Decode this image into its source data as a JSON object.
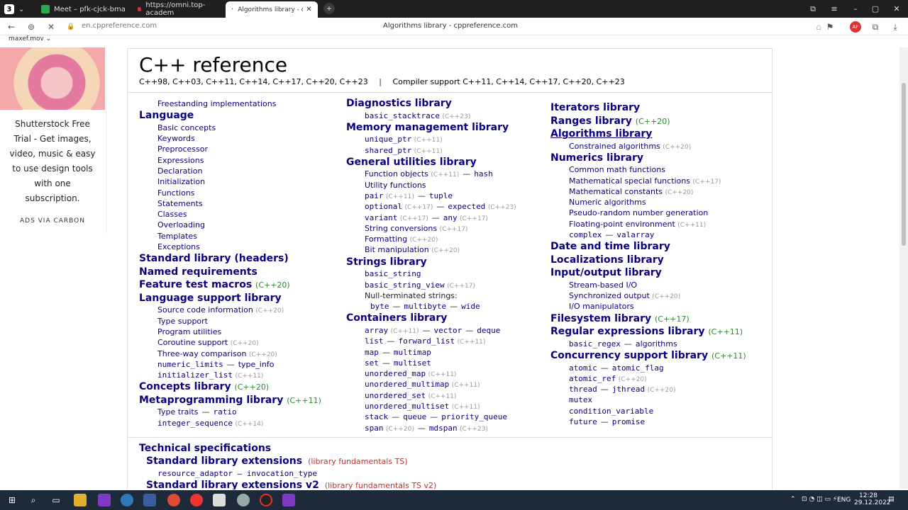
{
  "browser": {
    "tab_counter": "3",
    "tabs": [
      {
        "label": "Meet – pfk-cjck-bma"
      },
      {
        "label": "https://omni.top-academ"
      },
      {
        "label": "Algorithms library - cpp"
      }
    ],
    "new_tab": "+",
    "url": "en.cppreference.com",
    "page_title": "Algorithms library - cppreference.com",
    "bookmark": "maxef.mov"
  },
  "ad": {
    "text": "Shutterstock Free Trial - Get images, video, music & easy to use design tools with one subscription.",
    "via": "ADS VIA CARBON"
  },
  "page": {
    "title": "C++ reference",
    "versions_left": "C++98, C++03, C++11, C++14, C++17, C++20, C++23",
    "versions_sep": "|",
    "versions_right": "Compiler support C++11, C++14, C++17, C++20, C++23"
  },
  "col1": [
    {
      "t": "Freestanding implementations",
      "cls": "i"
    },
    {
      "t": "Language",
      "cls": "h"
    },
    {
      "t": "Basic concepts",
      "cls": "i"
    },
    {
      "t": "Keywords",
      "cls": "i"
    },
    {
      "t": "Preprocessor",
      "cls": "i"
    },
    {
      "t": "Expressions",
      "cls": "i"
    },
    {
      "t": "Declaration",
      "cls": "i"
    },
    {
      "t": "Initialization",
      "cls": "i"
    },
    {
      "t": "Functions",
      "cls": "i"
    },
    {
      "t": "Statements",
      "cls": "i"
    },
    {
      "t": "Classes",
      "cls": "i"
    },
    {
      "t": "Overloading",
      "cls": "i"
    },
    {
      "t": "Templates",
      "cls": "i"
    },
    {
      "t": "Exceptions",
      "cls": "i"
    },
    {
      "t": "Standard library (headers)",
      "cls": "h"
    },
    {
      "t": "Named requirements",
      "cls": "h"
    },
    {
      "t": "Feature test macros",
      "cls": "h",
      "v": "(C++20)"
    },
    {
      "t": "Language support library",
      "cls": "h"
    },
    {
      "t": "Source code information",
      "cls": "i",
      "v": "(C++20)"
    },
    {
      "t": "Type support",
      "cls": "i"
    },
    {
      "t": "Program utilities",
      "cls": "i"
    },
    {
      "t": "Coroutine support",
      "cls": "i",
      "v": "(C++20)"
    },
    {
      "t": "Three-way comparison",
      "cls": "i",
      "v": "(C++20)"
    },
    {
      "t": "numeric_limits",
      "cls": "i",
      "mono": true,
      "t2": "type_info"
    },
    {
      "t": "initializer_list",
      "cls": "i",
      "mono": true,
      "v": "(C++11)"
    },
    {
      "t": "Concepts library",
      "cls": "h",
      "v": "(C++20)"
    },
    {
      "t": "Metaprogramming library",
      "cls": "h",
      "v": "(C++11)"
    },
    {
      "t": "Type traits",
      "cls": "i",
      "t2": "ratio",
      "mono2": true
    },
    {
      "t": "integer_sequence",
      "cls": "i",
      "mono": true,
      "v": "(C++14)"
    }
  ],
  "col2": [
    {
      "t": "Diagnostics library",
      "cls": "h"
    },
    {
      "t": "basic_stacktrace",
      "cls": "i",
      "mono": true,
      "v": "(C++23)"
    },
    {
      "t": "Memory management library",
      "cls": "h"
    },
    {
      "t": "unique_ptr",
      "cls": "i",
      "mono": true,
      "v": "(C++11)"
    },
    {
      "t": "shared_ptr",
      "cls": "i",
      "mono": true,
      "v": "(C++11)"
    },
    {
      "t": "General utilities library",
      "cls": "h"
    },
    {
      "t": "Function objects",
      "cls": "i",
      "t2": "hash",
      "mono2": true,
      "v": "(C++11)"
    },
    {
      "t": "Utility functions",
      "cls": "i"
    },
    {
      "t": "pair",
      "cls": "i",
      "mono": true,
      "t2": "tuple",
      "mono2": true,
      "v": "(C++11)"
    },
    {
      "t": "optional",
      "cls": "i",
      "mono": true,
      "v": "(C++17)",
      "t2": "expected",
      "mono2": true,
      "v2": "(C++23)"
    },
    {
      "t": "variant",
      "cls": "i",
      "mono": true,
      "v": "(C++17)",
      "t2": "any",
      "mono2": true,
      "v2": "(C++17)"
    },
    {
      "t": "String conversions",
      "cls": "i",
      "v": "(C++17)"
    },
    {
      "t": "Formatting",
      "cls": "i",
      "v": "(C++20)"
    },
    {
      "t": "Bit manipulation",
      "cls": "i",
      "v": "(C++20)"
    },
    {
      "t": "Strings library",
      "cls": "h"
    },
    {
      "t": "basic_string",
      "cls": "i",
      "mono": true
    },
    {
      "t": "basic_string_view",
      "cls": "i",
      "mono": true,
      "v": "(C++17)"
    },
    {
      "t": "Null-terminated strings:",
      "cls": "i",
      "plain": true
    },
    {
      "t": "byte",
      "cls": "ii",
      "mono": true,
      "t2": "multibyte",
      "mono2": true,
      "t3": "wide",
      "mono3": true
    },
    {
      "t": "Containers library",
      "cls": "h"
    },
    {
      "t": "array",
      "cls": "i",
      "mono": true,
      "v": "(C++11)",
      "t2": "vector",
      "mono2": true,
      "t3": "deque",
      "mono3": true
    },
    {
      "t": "list",
      "cls": "i",
      "mono": true,
      "t2": "forward_list",
      "mono2": true,
      "v2": "(C++11)"
    },
    {
      "t": "map",
      "cls": "i",
      "mono": true,
      "t2": "multimap",
      "mono2": true
    },
    {
      "t": "set",
      "cls": "i",
      "mono": true,
      "t2": "multiset",
      "mono2": true
    },
    {
      "t": "unordered_map",
      "cls": "i",
      "mono": true,
      "v": "(C++11)"
    },
    {
      "t": "unordered_multimap",
      "cls": "i",
      "mono": true,
      "v": "(C++11)"
    },
    {
      "t": "unordered_set",
      "cls": "i",
      "mono": true,
      "v": "(C++11)"
    },
    {
      "t": "unordered_multiset",
      "cls": "i",
      "mono": true,
      "v": "(C++11)"
    },
    {
      "t": "stack",
      "cls": "i",
      "mono": true,
      "t2": "queue",
      "mono2": true,
      "t3": "priority_queue",
      "mono3": true
    },
    {
      "t": "span",
      "cls": "i",
      "mono": true,
      "v": "(C++20)",
      "t2": "mdspan",
      "mono2": true,
      "v2": "(C++23)"
    }
  ],
  "col3": [
    {
      "t": "Iterators library",
      "cls": "h"
    },
    {
      "t": "Ranges library",
      "cls": "h",
      "v": "(C++20)"
    },
    {
      "t": "Algorithms library",
      "cls": "h",
      "active": true
    },
    {
      "t": "Constrained algorithms",
      "cls": "i",
      "v": "(C++20)"
    },
    {
      "t": "Numerics library",
      "cls": "h"
    },
    {
      "t": "Common math functions",
      "cls": "i"
    },
    {
      "t": "Mathematical special functions",
      "cls": "i",
      "v": "(C++17)"
    },
    {
      "t": "Mathematical constants",
      "cls": "i",
      "v": "(C++20)"
    },
    {
      "t": "Numeric algorithms",
      "cls": "i"
    },
    {
      "t": "Pseudo-random number generation",
      "cls": "i"
    },
    {
      "t": "Floating-point environment",
      "cls": "i",
      "v": "(C++11)"
    },
    {
      "t": "complex",
      "cls": "i",
      "mono": true,
      "t2": "valarray",
      "mono2": true
    },
    {
      "t": "Date and time library",
      "cls": "h"
    },
    {
      "t": "Localizations library",
      "cls": "h"
    },
    {
      "t": "Input/output library",
      "cls": "h"
    },
    {
      "t": "Stream-based I/O",
      "cls": "i"
    },
    {
      "t": "Synchronized output",
      "cls": "i",
      "v": "(C++20)"
    },
    {
      "t": "I/O manipulators",
      "cls": "i"
    },
    {
      "t": "Filesystem library",
      "cls": "h",
      "v": "(C++17)"
    },
    {
      "t": "Regular expressions library",
      "cls": "h",
      "v": "(C++11)"
    },
    {
      "t": "basic_regex",
      "cls": "i",
      "mono": true,
      "t2": "algorithms",
      "mono2": false
    },
    {
      "t": "Concurrency support library",
      "cls": "h",
      "v": "(C++11)"
    },
    {
      "t": "atomic",
      "cls": "i",
      "mono": true,
      "t2": "atomic_flag",
      "mono2": true
    },
    {
      "t": "atomic_ref",
      "cls": "i",
      "mono": true,
      "v": "(C++20)"
    },
    {
      "t": "thread",
      "cls": "i",
      "mono": true,
      "t2": "jthread",
      "mono2": true,
      "v2": "(C++20)"
    },
    {
      "t": "mutex",
      "cls": "i",
      "mono": true
    },
    {
      "t": "condition_variable",
      "cls": "i",
      "mono": true
    },
    {
      "t": "future",
      "cls": "i",
      "mono": true,
      "t2": "promise",
      "mono2": true
    }
  ],
  "tech": {
    "heading": "Technical specifications",
    "ext1": "Standard library extensions",
    "ext1_note": "(library fundamentals TS)",
    "ext1_items": "resource_adaptor — invocation_type",
    "ext2": "Standard library extensions v2",
    "ext2_note": "(library fundamentals TS v2)"
  },
  "taskbar": {
    "lang": "ENG",
    "time": "12:28",
    "date": "29.12.2022"
  },
  "dash": "—"
}
